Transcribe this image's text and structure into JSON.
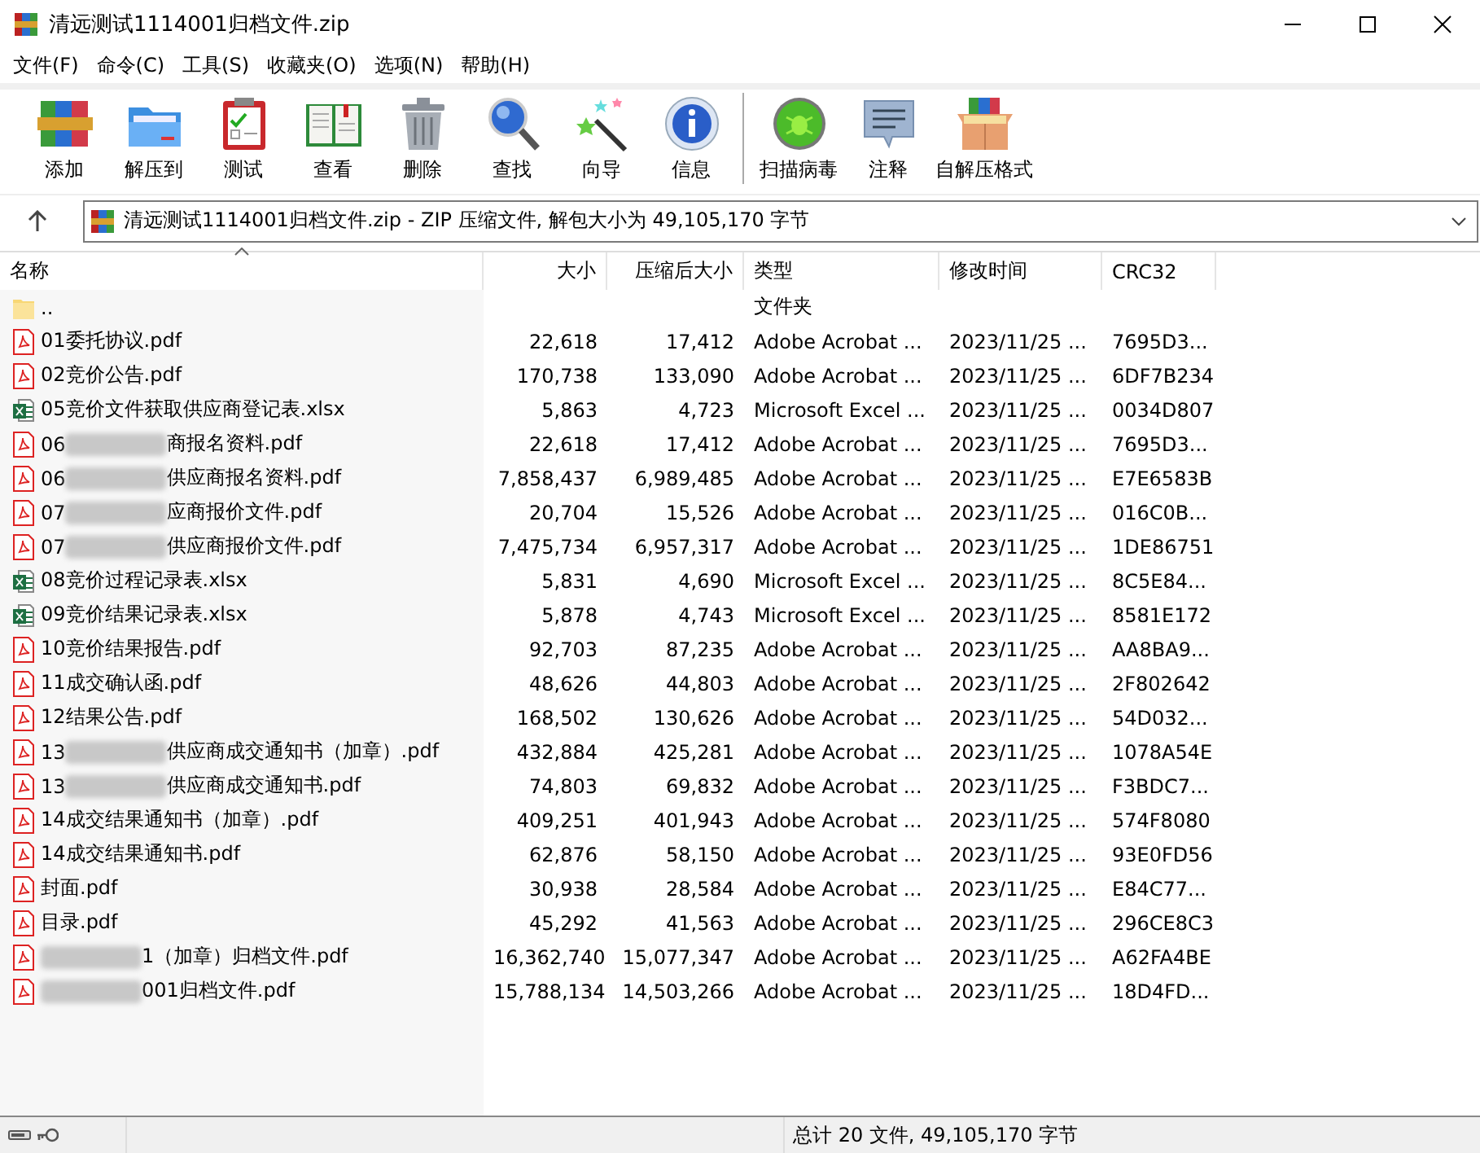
{
  "window": {
    "title": "清远测试1114001归档文件.zip"
  },
  "menu": [
    "文件(F)",
    "命令(C)",
    "工具(S)",
    "收藏夹(O)",
    "选项(N)",
    "帮助(H)"
  ],
  "toolbar": [
    {
      "label": "添加",
      "kind": "add"
    },
    {
      "label": "解压到",
      "kind": "extract"
    },
    {
      "label": "测试",
      "kind": "test"
    },
    {
      "label": "查看",
      "kind": "view"
    },
    {
      "label": "删除",
      "kind": "delete"
    },
    {
      "label": "查找",
      "kind": "find"
    },
    {
      "label": "向导",
      "kind": "wizard"
    },
    {
      "label": "信息",
      "kind": "info"
    },
    {
      "label": "扫描病毒",
      "kind": "scan"
    },
    {
      "label": "注释",
      "kind": "comment"
    },
    {
      "label": "自解压格式",
      "kind": "sfx"
    }
  ],
  "address": {
    "text": "清远测试1114001归档文件.zip - ZIP 压缩文件, 解包大小为 49,105,170 字节"
  },
  "columns": [
    {
      "label": "名称",
      "sorted": true
    },
    {
      "label": "大小",
      "sorted": false
    },
    {
      "label": "压缩后大小",
      "sorted": false
    },
    {
      "label": "类型",
      "sorted": false
    },
    {
      "label": "修改时间",
      "sorted": false
    },
    {
      "label": "CRC32",
      "sorted": false
    }
  ],
  "rows": [
    {
      "kind": "folder",
      "parts": [
        {
          "kind": "text",
          "text": ".."
        }
      ],
      "type": "文件夹"
    },
    {
      "kind": "pdf",
      "parts": [
        {
          "kind": "text",
          "text": "01委托协议.pdf"
        }
      ],
      "size": "22,618",
      "packed": "17,412",
      "type": "Adobe Acrobat ...",
      "modified": "2023/11/25 ...",
      "crc": "7695D3..."
    },
    {
      "kind": "pdf",
      "parts": [
        {
          "kind": "text",
          "text": "02竞价公告.pdf"
        }
      ],
      "size": "170,738",
      "packed": "133,090",
      "type": "Adobe Acrobat ...",
      "modified": "2023/11/25 ...",
      "crc": "6DF7B234"
    },
    {
      "kind": "excel",
      "parts": [
        {
          "kind": "text",
          "text": "05竞价文件获取供应商登记表.xlsx"
        }
      ],
      "size": "5,863",
      "packed": "4,723",
      "type": "Microsoft Excel ...",
      "modified": "2023/11/25 ...",
      "crc": "0034D807"
    },
    {
      "kind": "pdf",
      "parts": [
        {
          "kind": "text",
          "text": "06"
        },
        {
          "kind": "blur"
        },
        {
          "kind": "text",
          "text": "商报名资料.pdf"
        }
      ],
      "size": "22,618",
      "packed": "17,412",
      "type": "Adobe Acrobat ...",
      "modified": "2023/11/25 ...",
      "crc": "7695D3..."
    },
    {
      "kind": "pdf",
      "parts": [
        {
          "kind": "text",
          "text": "06"
        },
        {
          "kind": "blur"
        },
        {
          "kind": "text",
          "text": "供应商报名资料.pdf"
        }
      ],
      "size": "7,858,437",
      "packed": "6,989,485",
      "type": "Adobe Acrobat ...",
      "modified": "2023/11/25 ...",
      "crc": "E7E6583B"
    },
    {
      "kind": "pdf",
      "parts": [
        {
          "kind": "text",
          "text": "07"
        },
        {
          "kind": "blur"
        },
        {
          "kind": "text",
          "text": "应商报价文件.pdf"
        }
      ],
      "size": "20,704",
      "packed": "15,526",
      "type": "Adobe Acrobat ...",
      "modified": "2023/11/25 ...",
      "crc": "016C0B..."
    },
    {
      "kind": "pdf",
      "parts": [
        {
          "kind": "text",
          "text": "07"
        },
        {
          "kind": "blur"
        },
        {
          "kind": "text",
          "text": "供应商报价文件.pdf"
        }
      ],
      "size": "7,475,734",
      "packed": "6,957,317",
      "type": "Adobe Acrobat ...",
      "modified": "2023/11/25 ...",
      "crc": "1DE86751"
    },
    {
      "kind": "excel",
      "parts": [
        {
          "kind": "text",
          "text": "08竞价过程记录表.xlsx"
        }
      ],
      "size": "5,831",
      "packed": "4,690",
      "type": "Microsoft Excel ...",
      "modified": "2023/11/25 ...",
      "crc": "8C5E84..."
    },
    {
      "kind": "excel",
      "parts": [
        {
          "kind": "text",
          "text": "09竞价结果记录表.xlsx"
        }
      ],
      "size": "5,878",
      "packed": "4,743",
      "type": "Microsoft Excel ...",
      "modified": "2023/11/25 ...",
      "crc": "8581E172"
    },
    {
      "kind": "pdf",
      "parts": [
        {
          "kind": "text",
          "text": "10竞价结果报告.pdf"
        }
      ],
      "size": "92,703",
      "packed": "87,235",
      "type": "Adobe Acrobat ...",
      "modified": "2023/11/25 ...",
      "crc": "AA8BA9..."
    },
    {
      "kind": "pdf",
      "parts": [
        {
          "kind": "text",
          "text": "11成交确认函.pdf"
        }
      ],
      "size": "48,626",
      "packed": "44,803",
      "type": "Adobe Acrobat ...",
      "modified": "2023/11/25 ...",
      "crc": "2F802642"
    },
    {
      "kind": "pdf",
      "parts": [
        {
          "kind": "text",
          "text": "12结果公告.pdf"
        }
      ],
      "size": "168,502",
      "packed": "130,626",
      "type": "Adobe Acrobat ...",
      "modified": "2023/11/25 ...",
      "crc": "54D032..."
    },
    {
      "kind": "pdf",
      "parts": [
        {
          "kind": "text",
          "text": "13"
        },
        {
          "kind": "blur"
        },
        {
          "kind": "text",
          "text": "供应商成交通知书（加章）.pdf"
        }
      ],
      "size": "432,884",
      "packed": "425,281",
      "type": "Adobe Acrobat ...",
      "modified": "2023/11/25 ...",
      "crc": "1078A54E"
    },
    {
      "kind": "pdf",
      "parts": [
        {
          "kind": "text",
          "text": "13"
        },
        {
          "kind": "blur"
        },
        {
          "kind": "text",
          "text": "供应商成交通知书.pdf"
        }
      ],
      "size": "74,803",
      "packed": "69,832",
      "type": "Adobe Acrobat ...",
      "modified": "2023/11/25 ...",
      "crc": "F3BDC7..."
    },
    {
      "kind": "pdf",
      "parts": [
        {
          "kind": "text",
          "text": "14成交结果通知书（加章）.pdf"
        }
      ],
      "size": "409,251",
      "packed": "401,943",
      "type": "Adobe Acrobat ...",
      "modified": "2023/11/25 ...",
      "crc": "574F8080"
    },
    {
      "kind": "pdf",
      "parts": [
        {
          "kind": "text",
          "text": "14成交结果通知书.pdf"
        }
      ],
      "size": "62,876",
      "packed": "58,150",
      "type": "Adobe Acrobat ...",
      "modified": "2023/11/25 ...",
      "crc": "93E0FD56"
    },
    {
      "kind": "pdf",
      "parts": [
        {
          "kind": "text",
          "text": "封面.pdf"
        }
      ],
      "size": "30,938",
      "packed": "28,584",
      "type": "Adobe Acrobat ...",
      "modified": "2023/11/25 ...",
      "crc": "E84C77..."
    },
    {
      "kind": "pdf",
      "parts": [
        {
          "kind": "text",
          "text": "目录.pdf"
        }
      ],
      "size": "45,292",
      "packed": "41,563",
      "type": "Adobe Acrobat ...",
      "modified": "2023/11/25 ...",
      "crc": "296CE8C3"
    },
    {
      "kind": "pdf",
      "parts": [
        {
          "kind": "blur"
        },
        {
          "kind": "text",
          "text": "1（加章）归档文件.pdf"
        }
      ],
      "size": "16,362,740",
      "packed": "15,077,347",
      "type": "Adobe Acrobat ...",
      "modified": "2023/11/25 ...",
      "crc": "A62FA4BE"
    },
    {
      "kind": "pdf",
      "parts": [
        {
          "kind": "blur"
        },
        {
          "kind": "text",
          "text": "001归档文件.pdf"
        }
      ],
      "size": "15,788,134",
      "packed": "14,503,266",
      "type": "Adobe Acrobat ...",
      "modified": "2023/11/25 ...",
      "crc": "18D4FD..."
    }
  ],
  "status_bar": {
    "text": "总计 20 文件, 49,105,170 字节"
  }
}
